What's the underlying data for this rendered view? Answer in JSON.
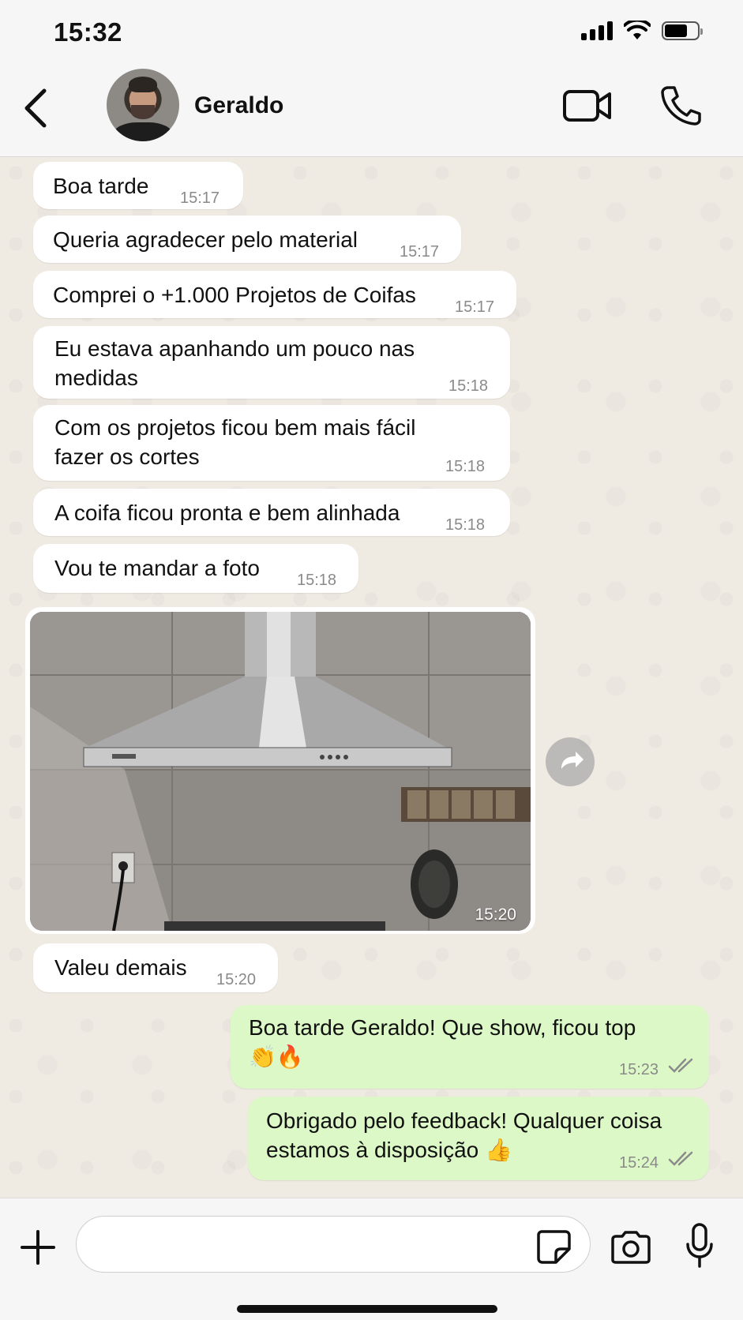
{
  "status_bar": {
    "time": "15:32"
  },
  "header": {
    "contact_name": "Geraldo",
    "icons": [
      "chevron-left-icon",
      "video-camera-icon",
      "phone-icon"
    ]
  },
  "messages": [
    {
      "direction": "in",
      "text": "Boa tarde",
      "time": "15:17"
    },
    {
      "direction": "in",
      "text": "Queria agradecer pelo material",
      "time": "15:17"
    },
    {
      "direction": "in",
      "text": "Comprei o +1.000 Projetos de Coifas",
      "time": "15:17"
    },
    {
      "direction": "in",
      "text": "Eu estava apanhando um pouco nas\nmedidas",
      "time": "15:18"
    },
    {
      "direction": "in",
      "text": "Com os projetos ficou bem mais fácil\nfazer os cortes",
      "time": "15:18"
    },
    {
      "direction": "in",
      "text": "A coifa ficou pronta e bem alinhada",
      "time": "15:18"
    },
    {
      "direction": "in",
      "text": "Vou te mandar a foto",
      "time": "15:18"
    },
    {
      "direction": "in",
      "type": "photo",
      "time": "15:20"
    },
    {
      "direction": "in",
      "text": "Valeu demais",
      "time": "15:20"
    },
    {
      "direction": "out",
      "text": "Boa tarde Geraldo! Que show, ficou top\n👏🔥",
      "time": "15:23"
    },
    {
      "direction": "out",
      "text": "Obrigado pelo feedback! Qualquer coisa\nestamos à disposição 👍",
      "time": "15:24"
    }
  ],
  "input_bar": {
    "placeholder": "",
    "icons": [
      "plus-icon",
      "sticker-icon",
      "camera-icon",
      "microphone-icon"
    ]
  },
  "colors": {
    "incoming_bubble": "#ffffff",
    "outgoing_bubble": "#dcf8c6",
    "chat_background": "#efeae2",
    "read_ticks": "#8a8a8a"
  }
}
